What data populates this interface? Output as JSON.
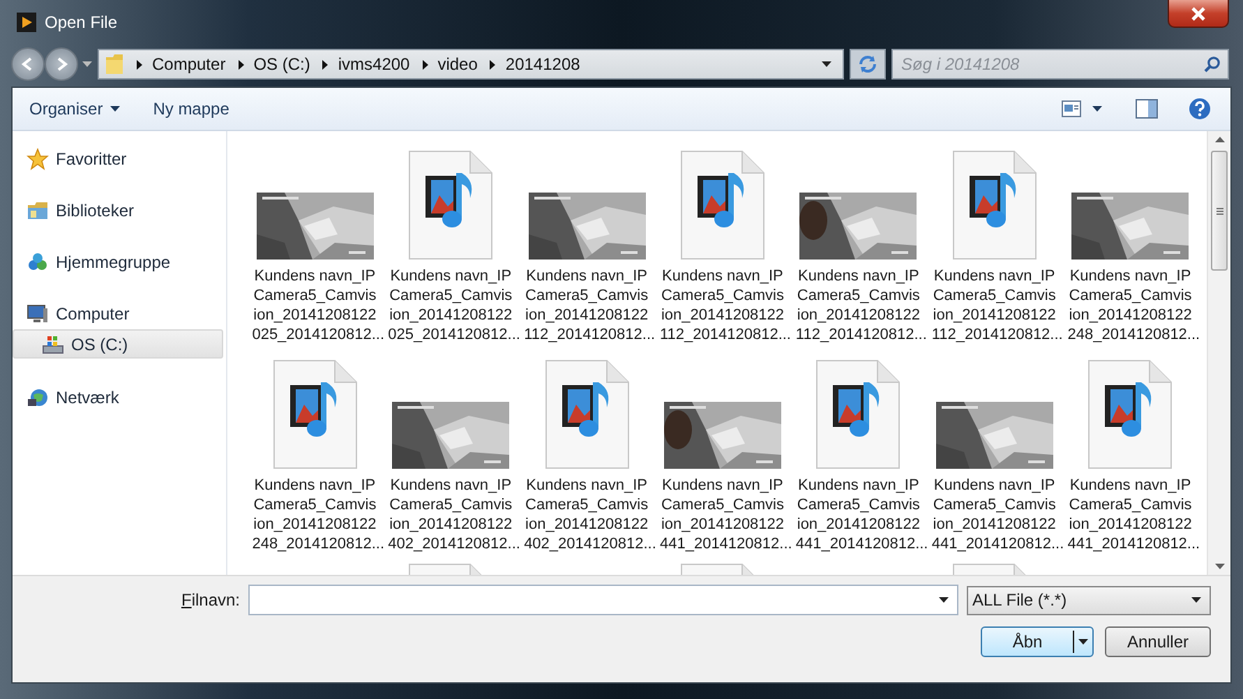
{
  "window": {
    "title": "Open File"
  },
  "address": {
    "crumbs": [
      "Computer",
      "OS (C:)",
      "ivms4200",
      "video",
      "20141208"
    ]
  },
  "search": {
    "placeholder": "Søg i 20141208"
  },
  "toolbar": {
    "organize": "Organiser",
    "new_folder": "Ny mappe"
  },
  "sidebar": {
    "items": [
      {
        "label": "Favoritter",
        "kind": "star",
        "selected": false
      },
      {
        "label": "Biblioteker",
        "kind": "library",
        "selected": false
      },
      {
        "label": "Hjemmegruppe",
        "kind": "homegroup",
        "selected": false
      },
      {
        "label": "Computer",
        "kind": "computer",
        "selected": false,
        "children": [
          {
            "label": "OS (C:)",
            "kind": "drive",
            "selected": true
          }
        ]
      },
      {
        "label": "Netværk",
        "kind": "network",
        "selected": false
      }
    ]
  },
  "files": {
    "rows": [
      [
        {
          "kind": "thumbnail",
          "name": "Kundens navn_IP Camera5_Camvis ion_20141208122 025_2014120812..."
        },
        {
          "kind": "media",
          "name": "Kundens navn_IP Camera5_Camvis ion_20141208122 025_2014120812..."
        },
        {
          "kind": "thumbnail",
          "name": "Kundens navn_IP Camera5_Camvis ion_20141208122 112_2014120812..."
        },
        {
          "kind": "media",
          "name": "Kundens navn_IP Camera5_Camvis ion_20141208122 112_2014120812..."
        },
        {
          "kind": "thumbnail",
          "name": "Kundens navn_IP Camera5_Camvis ion_20141208122 112_2014120812..."
        },
        {
          "kind": "media",
          "name": "Kundens navn_IP Camera5_Camvis ion_20141208122 112_2014120812..."
        },
        {
          "kind": "thumbnail",
          "name": "Kundens navn_IP Camera5_Camvis ion_20141208122 248_2014120812..."
        }
      ],
      [
        {
          "kind": "media",
          "name": "Kundens navn_IP Camera5_Camvis ion_20141208122 248_2014120812..."
        },
        {
          "kind": "thumbnail",
          "name": "Kundens navn_IP Camera5_Camvis ion_20141208122 402_2014120812..."
        },
        {
          "kind": "media",
          "name": "Kundens navn_IP Camera5_Camvis ion_20141208122 402_2014120812..."
        },
        {
          "kind": "thumbnail",
          "name": "Kundens navn_IP Camera5_Camvis ion_20141208122 441_2014120812..."
        },
        {
          "kind": "media",
          "name": "Kundens navn_IP Camera5_Camvis ion_20141208122 441_2014120812..."
        },
        {
          "kind": "thumbnail",
          "name": "Kundens navn_IP Camera5_Camvis ion_20141208122 441_2014120812..."
        },
        {
          "kind": "media",
          "name": "Kundens navn_IP Camera5_Camvis ion_20141208122 441_2014120812..."
        }
      ],
      [
        {
          "kind": "empty"
        },
        {
          "kind": "media-top"
        },
        {
          "kind": "empty"
        },
        {
          "kind": "media-top"
        },
        {
          "kind": "empty"
        },
        {
          "kind": "media-top"
        },
        {
          "kind": "empty"
        }
      ]
    ]
  },
  "footer": {
    "filename_label": "Filnavn:",
    "filter": "ALL File (*.*)",
    "open": "Åbn",
    "cancel": "Annuller"
  }
}
